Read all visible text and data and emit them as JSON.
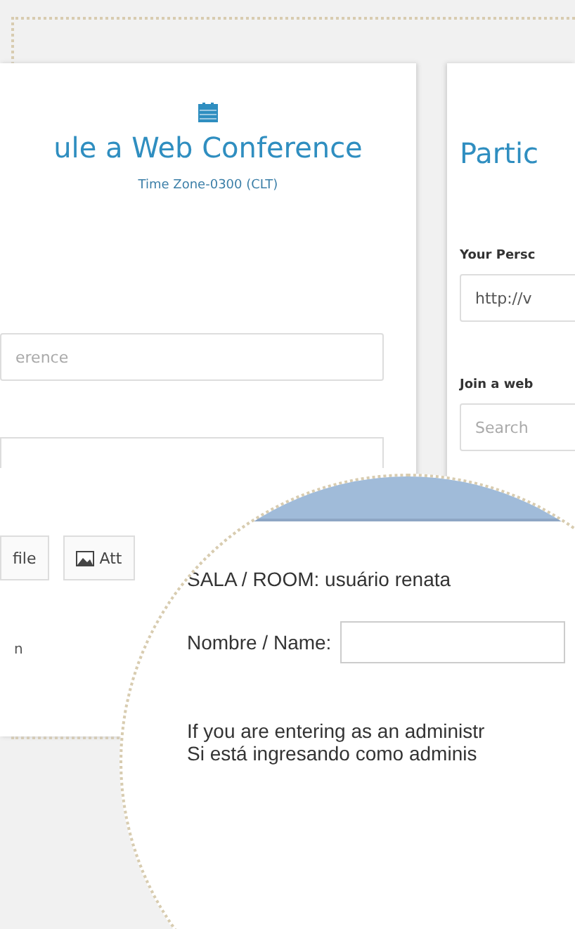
{
  "schedule_panel": {
    "title": "ule a Web Conference",
    "subtitle": "Time Zone-0300 (CLT)",
    "name_field": {
      "placeholder": "erence"
    },
    "buttons": [
      {
        "label": "file",
        "kind": "text"
      },
      {
        "label": "Att",
        "kind": "image"
      }
    ],
    "footer_text": "n"
  },
  "participate_panel": {
    "title": "Partic",
    "personal_label": "Your Persc",
    "personal_link": {
      "value": "http://v"
    },
    "join_label": "Join a web",
    "search_field": {
      "placeholder": "Search"
    }
  },
  "magnifier": {
    "room": "SALA / ROOM: usuário renata",
    "name_label": "Nombre / Name:",
    "notes": [
      "If you are entering as an administr",
      "Si está ingresando como adminis"
    ]
  }
}
